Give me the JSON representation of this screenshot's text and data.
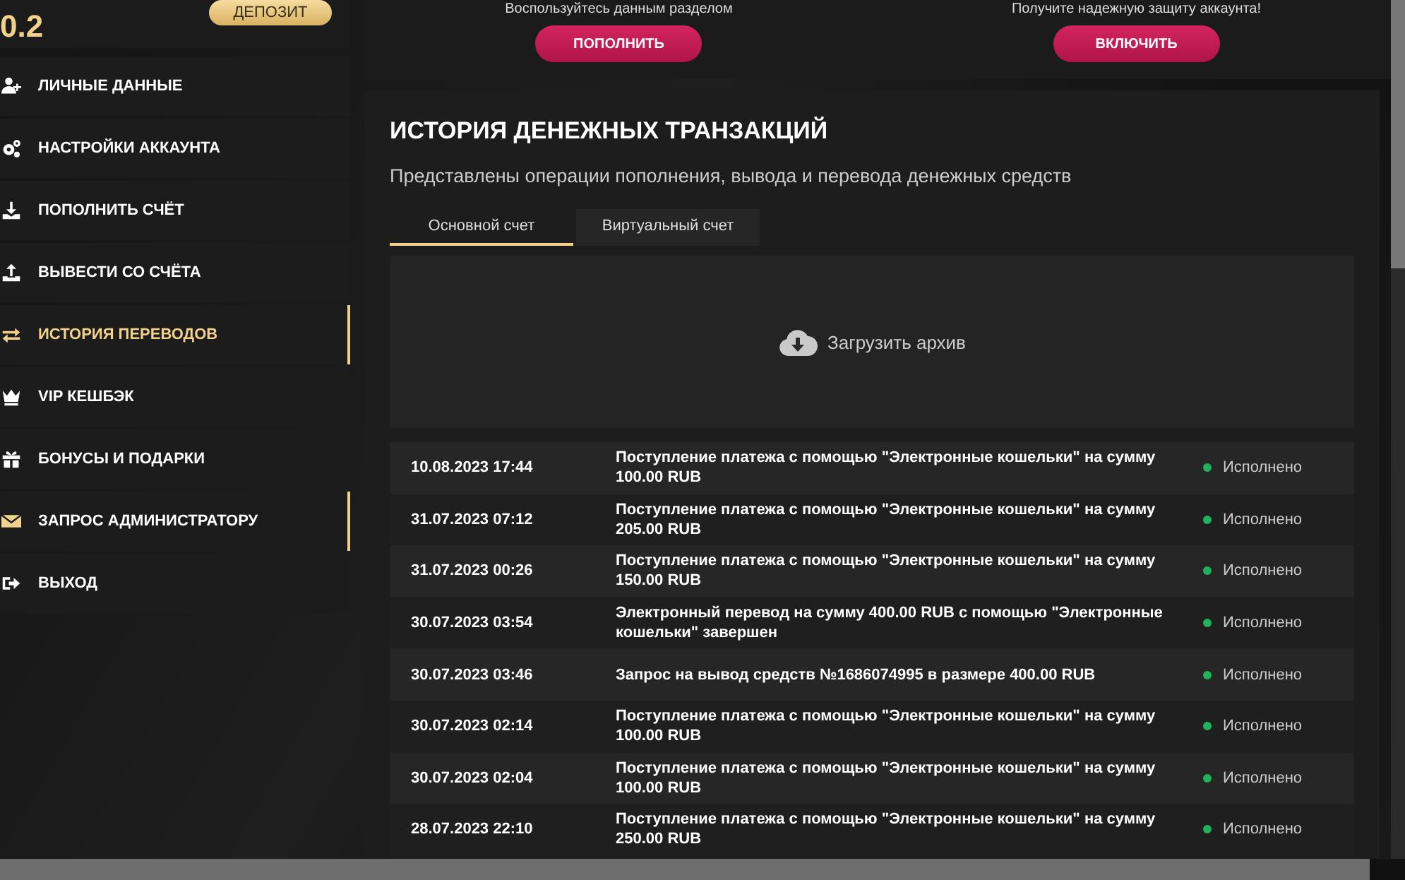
{
  "balance": {
    "amount": "0.2",
    "deposit_button": "ДЕПОЗИТ"
  },
  "promo_cards": [
    {
      "hint": "Воспользуйтесь данным разделом",
      "button": "ПОПОЛНИТЬ"
    },
    {
      "hint": "Получите надежную защиту аккаунта!",
      "button": "ВКЛЮЧИТЬ"
    }
  ],
  "sidebar": {
    "items": [
      {
        "kind": "user",
        "label": "ЛИЧНЫЕ ДАННЫЕ",
        "selected": false,
        "highlighted": false
      },
      {
        "kind": "gears",
        "label": "НАСТРОЙКИ АККАУНТА",
        "selected": false,
        "highlighted": false
      },
      {
        "kind": "download",
        "label": "ПОПОЛНИТЬ СЧЁТ",
        "selected": false,
        "highlighted": false
      },
      {
        "kind": "upload",
        "label": "ВЫВЕСТИ СО СЧЁТА",
        "selected": false,
        "highlighted": false
      },
      {
        "kind": "arrows",
        "label": "ИСТОРИЯ ПЕРЕВОДОВ",
        "selected": true,
        "highlighted": true
      },
      {
        "kind": "crown",
        "label": "VIP КЕШБЭК",
        "selected": false,
        "highlighted": false
      },
      {
        "kind": "gift",
        "label": "БОНУСЫ И ПОДАРКИ",
        "selected": false,
        "highlighted": false
      },
      {
        "kind": "envelope",
        "label": "ЗАПРОС АДМИНИСТРАТОРУ",
        "selected": false,
        "highlighted": true
      },
      {
        "kind": "exit",
        "label": "ВЫХОД",
        "selected": false,
        "highlighted": false
      }
    ]
  },
  "history": {
    "title": "ИСТОРИЯ ДЕНЕЖНЫХ ТРАНЗАКЦИЙ",
    "subtitle": "Представлены операции пополнения, вывода и перевода денежных средств",
    "tabs": [
      {
        "label": "Основной счет",
        "selected": true
      },
      {
        "label": "Виртуальный счет",
        "selected": false
      }
    ],
    "archive_button": "Загрузить архив",
    "rows": [
      {
        "date": "10.08.2023 17:44",
        "description": "Поступление платежа с помощью \"Электронные кошельки\" на сумму 100.00 RUB",
        "status": "Исполнено",
        "color": "#1fb45c"
      },
      {
        "date": "31.07.2023 07:12",
        "description": "Поступление платежа с помощью \"Электронные кошельки\" на сумму 205.00 RUB",
        "status": "Исполнено",
        "color": "#1fb45c"
      },
      {
        "date": "31.07.2023 00:26",
        "description": "Поступление платежа с помощью \"Электронные кошельки\" на сумму 150.00 RUB",
        "status": "Исполнено",
        "color": "#1fb45c"
      },
      {
        "date": "30.07.2023 03:54",
        "description": "Электронный перевод на сумму 400.00 RUB с помощью \"Электронные кошельки\" завершен",
        "status": "Исполнено",
        "color": "#1fb45c"
      },
      {
        "date": "30.07.2023 03:46",
        "description": "Запрос на вывод средств №1686074995 в размере 400.00 RUB",
        "status": "Исполнено",
        "color": "#1fb45c"
      },
      {
        "date": "30.07.2023 02:14",
        "description": "Поступление платежа с помощью \"Электронные кошельки\" на сумму 100.00 RUB",
        "status": "Исполнено",
        "color": "#1fb45c"
      },
      {
        "date": "30.07.2023 02:04",
        "description": "Поступление платежа с помощью \"Электронные кошельки\" на сумму 100.00 RUB",
        "status": "Исполнено",
        "color": "#1fb45c"
      },
      {
        "date": "28.07.2023 22:10",
        "description": "Поступление платежа с помощью \"Электронные кошельки\" на сумму 250.00 RUB",
        "status": "Исполнено",
        "color": "#1fb45c"
      }
    ]
  }
}
